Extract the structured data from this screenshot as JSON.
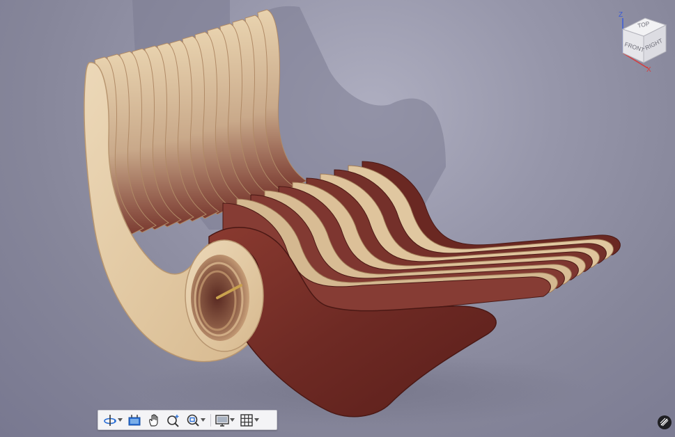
{
  "viewcube": {
    "top_label": "TOP",
    "front_label": "FRONT",
    "right_label": "RIGHT",
    "z_axis": "Z",
    "x_axis": "X",
    "z_color": "#3a5bd8",
    "x_color": "#d83a3a"
  },
  "toolbar": {
    "items": [
      {
        "icon": "orbit-icon",
        "has_menu": true
      },
      {
        "icon": "look-at-icon",
        "has_menu": false
      },
      {
        "icon": "pan-icon",
        "has_menu": false
      },
      {
        "icon": "zoom-icon",
        "has_menu": false
      },
      {
        "icon": "fit-icon",
        "has_menu": true
      },
      {
        "icon": "display-settings-icon",
        "has_menu": true
      },
      {
        "icon": "grid-icon",
        "has_menu": true
      }
    ]
  },
  "colors": {
    "light_wood": "#e2c9a3",
    "dark_wood": "#6e2a24",
    "background": "#9696aa",
    "toolbar_accent": "#2a6fd6"
  }
}
